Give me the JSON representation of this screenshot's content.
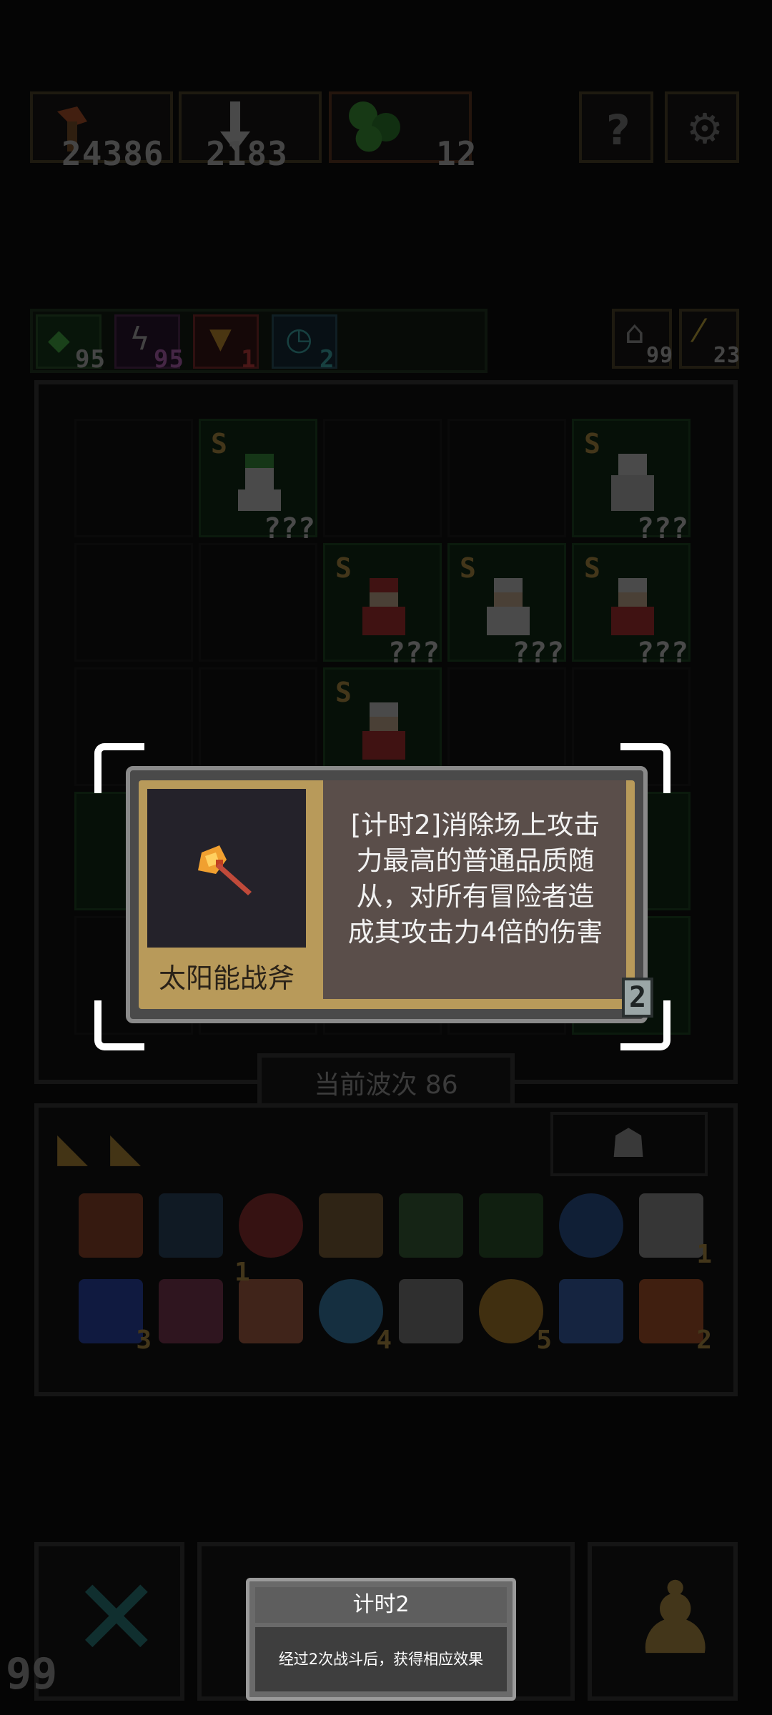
{
  "resources": [
    {
      "name": "axe-resource",
      "value": "24386"
    },
    {
      "name": "shovel-resource",
      "value": "2183"
    },
    {
      "name": "orb-resource",
      "value": "12"
    }
  ],
  "top_buttons": [
    "help-icon",
    "settings-icon"
  ],
  "status_chips": [
    {
      "icon": "green-gem-icon",
      "value": "95"
    },
    {
      "icon": "lightning-icon",
      "value": "95"
    },
    {
      "icon": "shield-icon",
      "value": "1"
    },
    {
      "icon": "clock-icon",
      "value": "2"
    }
  ],
  "right_chips": [
    {
      "icon": "boot-icon",
      "value": "99"
    },
    {
      "icon": "wand-icon",
      "value": "23"
    }
  ],
  "board_units_label": "???",
  "rank_label": "S",
  "wave_label": "当前波次 86",
  "card": {
    "item_name": "太阳能战斧",
    "description": "[计时2]消除场上攻击\n力最高的普通品质随\n从，对所有冒险者造\n成其攻击力4倍的伤害",
    "corner_badge": "2",
    "icon": "solar-battle-axe-icon"
  },
  "inventory_counts": [
    "1",
    "3",
    "1",
    "4",
    "5",
    "2"
  ],
  "bottom": {
    "left_count": "99",
    "tooltip_title": "计时2",
    "tooltip_body": "经过2次战斗后，获得相应效果"
  }
}
